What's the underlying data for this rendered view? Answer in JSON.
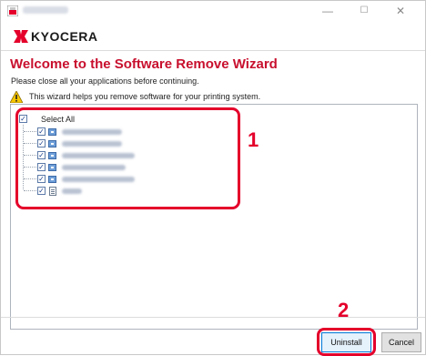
{
  "window": {
    "minimize_glyph": "—",
    "maximize_glyph": "☐",
    "close_glyph": "✕"
  },
  "brand": {
    "logo_text": "KYOCERA",
    "logo_color": "#e4002b"
  },
  "wizard": {
    "heading": "Welcome to the Software Remove Wizard",
    "instruction": "Please close all your applications before continuing.",
    "info_text": "This wizard helps you remove software for your printing system.",
    "info_icon": "warning-icon",
    "heading_color": "#c8102e"
  },
  "tree": {
    "select_all_label": "Select All",
    "select_all_checked": true,
    "items": [
      {
        "checked": true,
        "icon": "program-icon"
      },
      {
        "checked": true,
        "icon": "program-icon"
      },
      {
        "checked": true,
        "icon": "program-icon"
      },
      {
        "checked": true,
        "icon": "program-icon"
      },
      {
        "checked": true,
        "icon": "program-icon"
      },
      {
        "checked": true,
        "icon": "document-icon"
      }
    ]
  },
  "annotations": {
    "callout_1": "1",
    "callout_2": "2",
    "highlight_color": "#e4002b"
  },
  "buttons": {
    "uninstall": "Uninstall",
    "cancel": "Cancel"
  }
}
